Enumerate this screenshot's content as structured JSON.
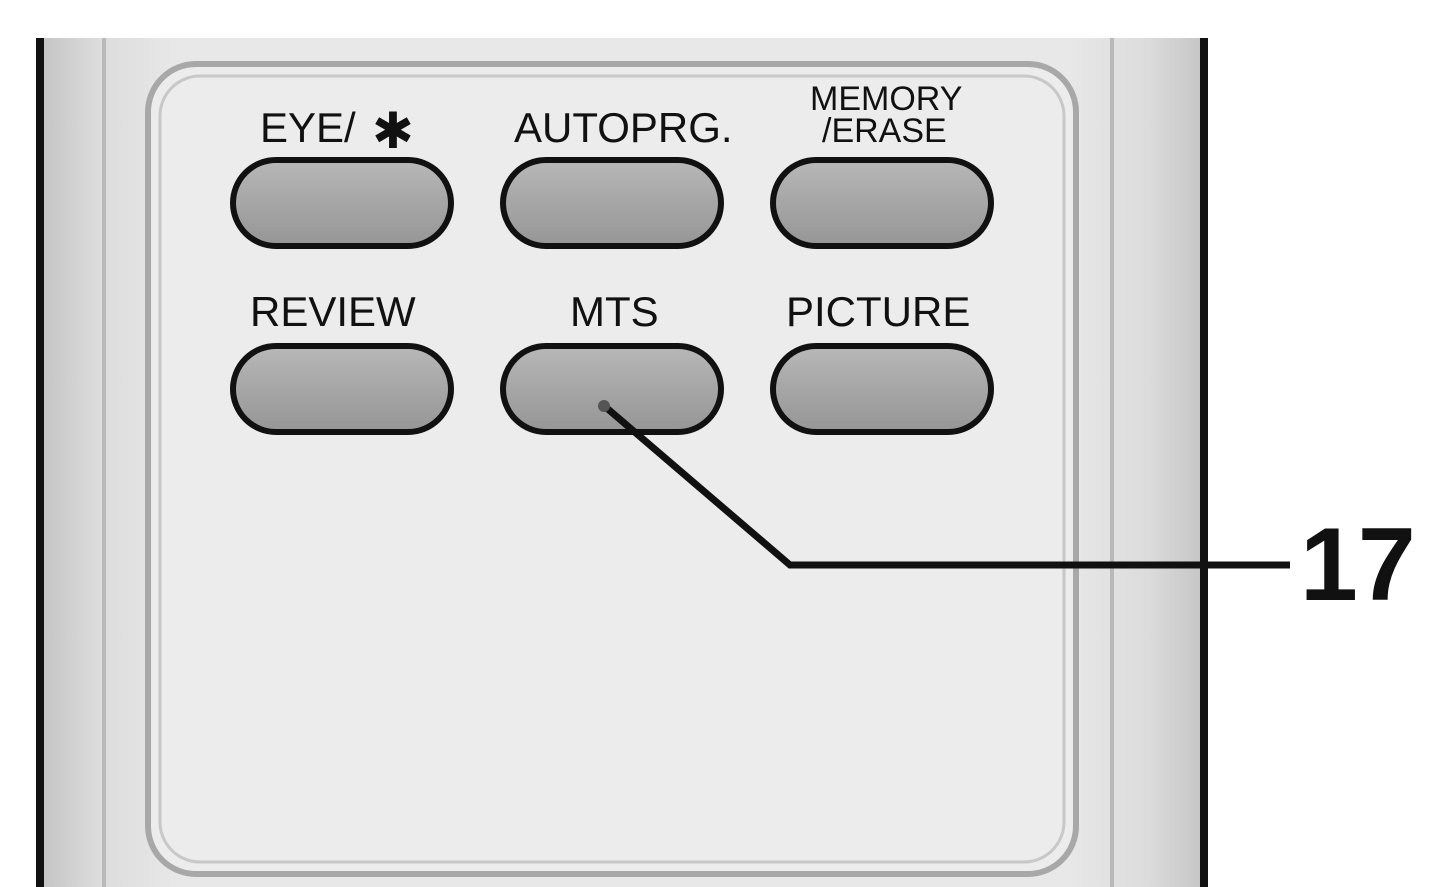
{
  "buttons": {
    "eye": {
      "label": "EYE/",
      "symbol": "✱"
    },
    "autoprg": {
      "label": "AUTOPRG."
    },
    "memory_erase": {
      "label_line1": "MEMORY",
      "label_line2": "/ERASE"
    },
    "review": {
      "label": "REVIEW"
    },
    "mts": {
      "label": "MTS"
    },
    "picture": {
      "label": "PICTURE"
    }
  },
  "callout": {
    "number": "17",
    "target": "MTS"
  },
  "colors": {
    "body": "#e6e6e6",
    "panel": "#ececec",
    "button_fill": "#a9a9a9",
    "outline": "#111111"
  }
}
